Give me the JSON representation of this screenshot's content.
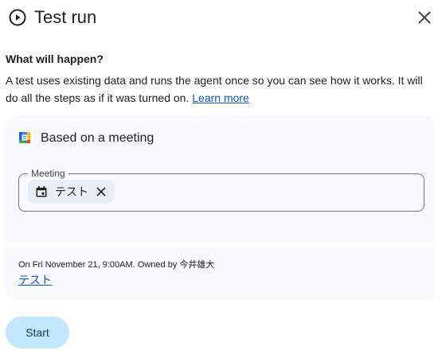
{
  "dialog": {
    "title": "Test run",
    "icons": {
      "title": "play-circle-icon",
      "close": "close-icon"
    }
  },
  "info": {
    "heading": "What will happen?",
    "description": "A test uses existing data and runs the agent once so you can see how it works. It will do all the steps as if it was turned on.",
    "learn_more": "Learn more"
  },
  "trigger": {
    "icon": "google-calendar-icon",
    "label": "Based on a meeting",
    "field_label": "Meeting",
    "chip": {
      "label": "テスト",
      "icon": "calendar-icon",
      "remove_icon": "close-icon"
    }
  },
  "meeting_details": {
    "meta": "On Fri November 21, 9:00AM. Owned by 今井雄大",
    "link": "テスト"
  },
  "actions": {
    "start": "Start"
  },
  "colors": {
    "accent": "#0b57d0",
    "button_bg": "#c2e7ff",
    "card_bg": "#f8fafd",
    "chip_bg": "#e9eef6"
  }
}
